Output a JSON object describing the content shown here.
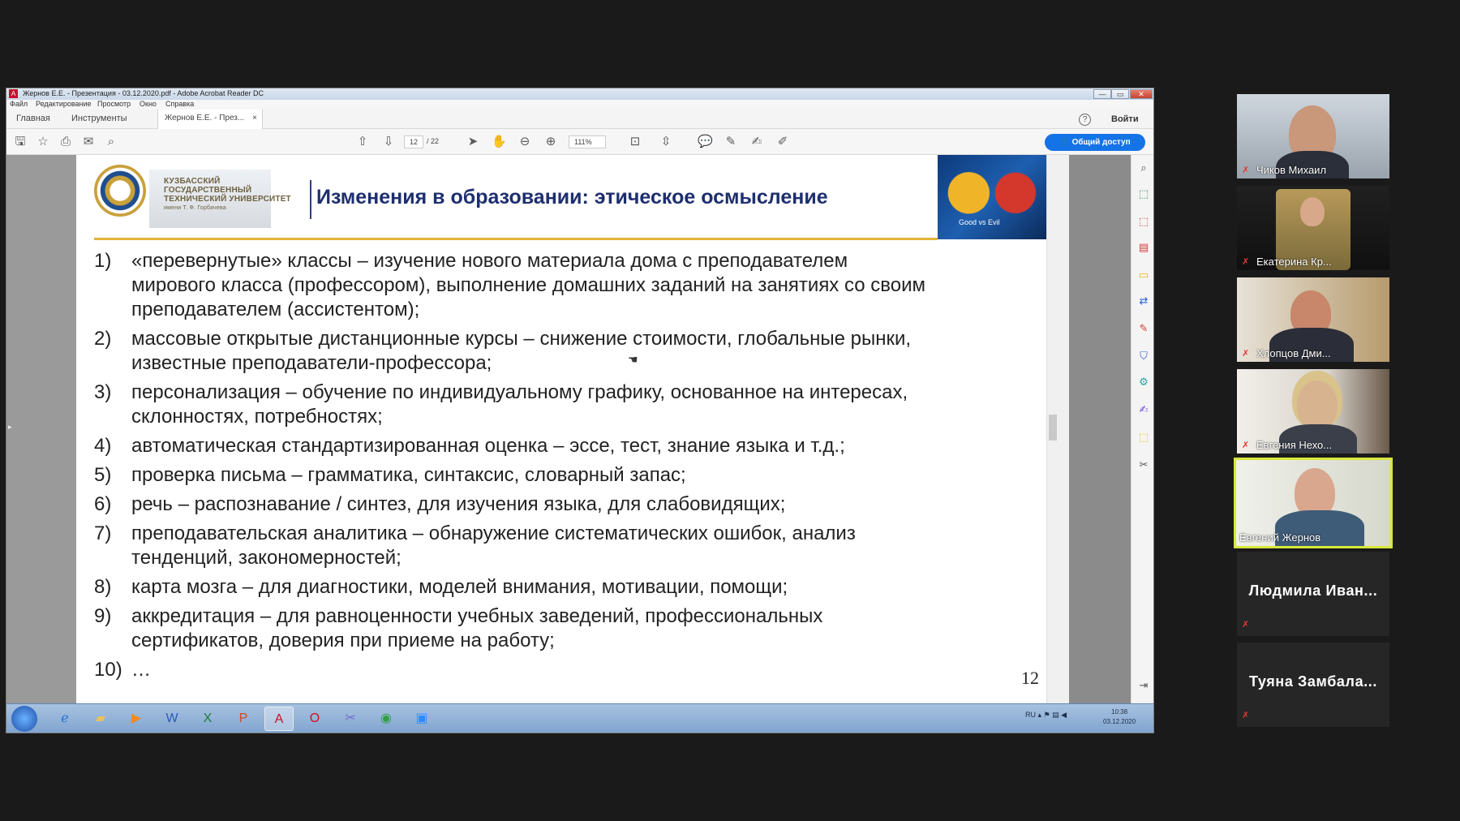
{
  "window": {
    "title": "Жернов Е.Е. - Презентация - 03.12.2020.pdf - Adobe Acrobat Reader DC",
    "controls": {
      "minimize": "—",
      "maximize": "▭",
      "close": "✕"
    },
    "app_icon": "A"
  },
  "menu": [
    "Файл",
    "Редактирование",
    "Просмотр",
    "Окно",
    "Справка"
  ],
  "tabs": {
    "home": "Главная",
    "tools": "Инструменты",
    "document": "Жернов Е.Е. - През...",
    "close": "×"
  },
  "header": {
    "help": "?",
    "sign_in": "Войти"
  },
  "toolbar": {
    "page_current": "12",
    "page_total": "/ 22",
    "zoom": "111%",
    "share": "Общий доступ",
    "icons": [
      "save-icon",
      "star-icon",
      "print-icon",
      "mail-icon",
      "search-icon",
      "arrow-up-icon",
      "arrow-down-icon",
      "pointer-icon",
      "hand-icon",
      "zoom-out-icon",
      "zoom-in-icon",
      "fit-page-icon",
      "scroll-mode-icon",
      "comment-icon",
      "pen-icon",
      "sign-icon",
      "fill-sign-icon"
    ]
  },
  "slide": {
    "university": {
      "line1": "КУЗБАССКИЙ ГОСУДАРСТВЕННЫЙ",
      "line2": "ТЕХНИЧЕСКИЙ УНИВЕРСИТЕТ",
      "line3": "имени Т. Ф. Горбачева"
    },
    "title": "Изменения в образовании: этическое осмысление",
    "corner_caption": "Good vs Evil",
    "items": [
      {
        "num": "1)",
        "text": "«перевернутые» классы – изучение нового материала дома с преподавателем\nмирового класса (профессором), выполнение домашних заданий на занятиях со своим\nпреподавателем (ассистентом);"
      },
      {
        "num": "2)",
        "text": "массовые открытые дистанционные курсы – снижение стоимости, глобальные рынки,\nизвестные преподаватели-профессора;"
      },
      {
        "num": "3)",
        "text": "персонализация – обучение по индивидуальному графику, основанное на интересах,\nсклонностях, потребностях;"
      },
      {
        "num": "4)",
        "text": "автоматическая стандартизированная оценка – эссе, тест, знание языка и т.д.;"
      },
      {
        "num": "5)",
        "text": "проверка письма – грамматика, синтаксис, словарный запас;"
      },
      {
        "num": "6)",
        "text": "речь – распознавание / синтез, для изучения языка, для слабовидящих;"
      },
      {
        "num": "7)",
        "text": "преподавательская аналитика – обнаружение систематических ошибок, анализ\nтенденций, закономерностей;"
      },
      {
        "num": "8)",
        "text": "карта мозга – для диагностики, моделей внимания, мотивации, помощи;"
      },
      {
        "num": "9)",
        "text": "аккредитация – для равноценности учебных заведений, профессиональных\nсертификатов, доверия при приеме на работу;"
      },
      {
        "num": "10)",
        "text": "…"
      }
    ],
    "page_number": "12"
  },
  "taskbar": {
    "tray": "RU",
    "time": "10:38",
    "date": "03.12.2020"
  },
  "participants": [
    {
      "name": "Чиков Михаил",
      "video": true
    },
    {
      "name": "Екатерина Кр...",
      "video": true
    },
    {
      "name": "Хлопцов Дми...",
      "video": true
    },
    {
      "name": "Евгения Нехо...",
      "video": true
    },
    {
      "name": "Евгений Жернов",
      "video": true,
      "speaking": true
    },
    {
      "name": "Людмила Иван...",
      "video": false
    },
    {
      "name": "Туяна Замбала...",
      "video": false
    }
  ],
  "colors": {
    "title": "#1d2f6f",
    "gold": "#e1b43a",
    "share": "#1473e6",
    "speaker": "#d7e83a",
    "mic_muted": "#e53935"
  }
}
